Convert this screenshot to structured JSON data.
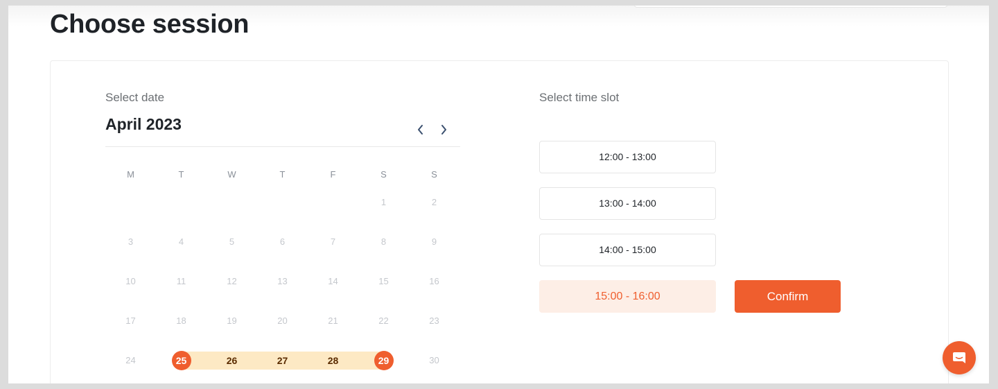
{
  "page": {
    "title": "Choose session"
  },
  "date_picker": {
    "label": "Select date",
    "month": "April 2023",
    "prev_icon": "chevron-left-icon",
    "next_icon": "chevron-right-icon",
    "weekdays": [
      "M",
      "T",
      "W",
      "T",
      "F",
      "S",
      "S"
    ],
    "weeks": [
      [
        "",
        "",
        "",
        "",
        "",
        "1",
        "2"
      ],
      [
        "3",
        "4",
        "5",
        "6",
        "7",
        "8",
        "9"
      ],
      [
        "10",
        "11",
        "12",
        "13",
        "14",
        "15",
        "16"
      ],
      [
        "17",
        "18",
        "19",
        "20",
        "21",
        "22",
        "23"
      ],
      [
        "24",
        "25",
        "26",
        "27",
        "28",
        "29",
        "30"
      ]
    ],
    "range_start": "25",
    "range_end": "29"
  },
  "time_slots": {
    "label": "Select time slot",
    "slots": [
      "12:00 - 13:00",
      "13:00 - 14:00",
      "14:00 - 15:00",
      "15:00 - 16:00"
    ],
    "selected": "15:00 - 16:00"
  },
  "confirm": {
    "label": "Confirm"
  },
  "chat": {
    "icon": "chat-icon"
  },
  "colors": {
    "accent": "#ef5e2e",
    "range_highlight": "#fde9c4",
    "selected_slot_bg": "#fdeee6"
  }
}
